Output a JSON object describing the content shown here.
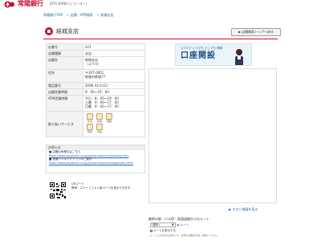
{
  "header": {
    "brand": "常陽銀行",
    "brand_sub": "JOYO BANK (ジョーヨー)"
  },
  "breadcrumb": [
    "常陽銀行TOP",
    "＞ 店舗・ATM検索",
    "＞ 結城支店"
  ],
  "page": {
    "title": "結城支店",
    "back_label": "店舗検索トップへ戻る"
  },
  "branch": {
    "rows": [
      {
        "k": "店番号",
        "v": "221"
      },
      {
        "k": "店舗種類",
        "v": "支店"
      },
      {
        "k": "店舗名",
        "v": "結城支店\n（ユウキ）"
      },
      {
        "k": "住所",
        "v": "〒307-0001\n結城市結城77"
      },
      {
        "k": "電話番号",
        "v": "0296-33-2121"
      },
      {
        "k": "店舗営業時間",
        "v": "9：00～15：00"
      },
      {
        "k": "ATM営業時間",
        "v": "平日　8：45～19：00\n土曜　9：00～17：00\n日曜　9：00～17：00"
      }
    ],
    "services_label": "取り扱いサービス",
    "services": [
      "外貨",
      "投信",
      "保険",
      "両替",
      "年金"
    ]
  },
  "banner": {
    "sub": "スマホで いつでも どこでも 簡単",
    "main": "口座開設"
  },
  "notice": {
    "heading": "お知らせ",
    "lines": [
      {
        "text": "■ 店舗の休業日はこちら",
        "link": false
      },
      {
        "text": "https://www.joyobank.co.jp/personal/branch/holiday.html",
        "link": true
      },
      {
        "text": "■ 常陽バンキングアプリのご案内",
        "link": false
      },
      {
        "text": "https://www.joyobank.co.jp/personal/service/app/index.html",
        "link": true
      }
    ]
  },
  "qr": {
    "title": "QRコード",
    "text": "携帯・スマートフォン用ページを表示できます。"
  },
  "map": {
    "link_label": "▶ 大きい地図を見る"
  },
  "route": {
    "heading": "最寄の駅・バス停・高速道路からのルート",
    "select_value": "(選択)",
    "go_label": "▶ ルート",
    "checkbox_label": "ルートを表示する",
    "note": "ルート上の表示は目安です。実際の道路状況をご確認ください。"
  }
}
